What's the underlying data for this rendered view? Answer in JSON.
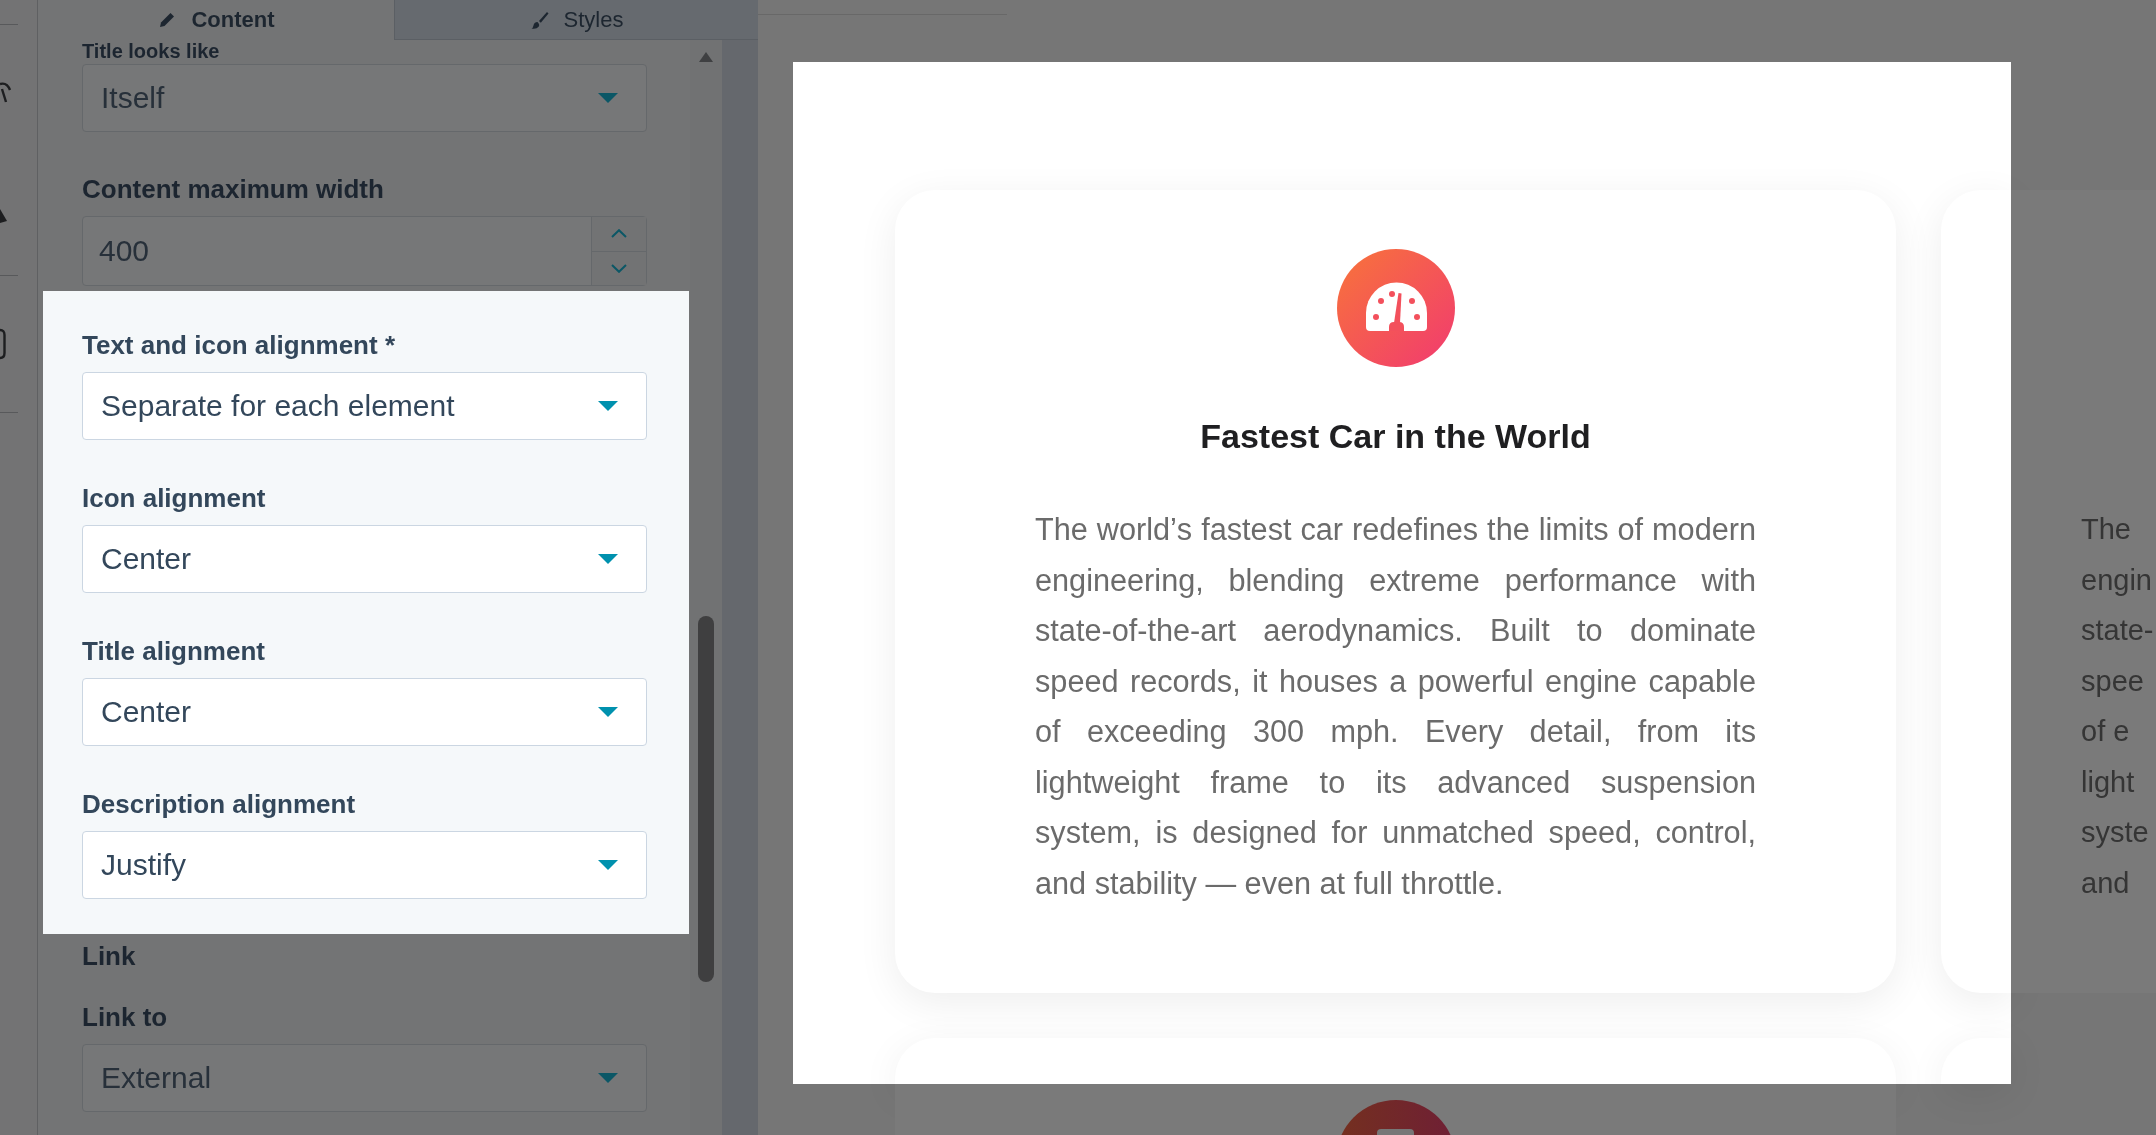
{
  "settings": {
    "tabs": [
      {
        "label": "Content",
        "selected": true
      },
      {
        "label": "Styles",
        "selected": false
      }
    ],
    "fields": [
      {
        "kind": "dropdown",
        "label": "Title looks like",
        "value": "Itself",
        "highlighted": false
      },
      {
        "kind": "number",
        "label": "Content maximum width",
        "value": "400",
        "highlighted": false
      },
      {
        "kind": "dropdown",
        "label": "Text and icon alignment *",
        "value": "Separate for each element",
        "highlighted": true
      },
      {
        "kind": "dropdown",
        "label": "Icon alignment",
        "value": "Center",
        "highlighted": true
      },
      {
        "kind": "dropdown",
        "label": "Title alignment",
        "value": "Center",
        "highlighted": true
      },
      {
        "kind": "dropdown",
        "label": "Description alignment",
        "value": "Justify",
        "highlighted": true
      },
      {
        "kind": "heading",
        "label": "Link",
        "highlighted": false
      },
      {
        "kind": "dropdown",
        "label": "Link to",
        "value": "External",
        "highlighted": false
      }
    ]
  },
  "preview": {
    "highlighted": true,
    "cards": [
      {
        "title": "Fastest Car in the World",
        "description": "The world’s fastest car redefines the limits of modern engineering, blending extreme performance with state-of-the-art aerodynamics. Built to dominate speed records, it houses a powerful engine capable of exceeding 300 mph. Every detail, from its lightweight frame to its advanced suspension system, is designed for unmatched speed, control, and stability — even at full throttle."
      },
      {
        "description_lines": [
          "The",
          "engin",
          "state-",
          "spee",
          "of e",
          "light",
          "syste",
          "and"
        ]
      }
    ]
  }
}
